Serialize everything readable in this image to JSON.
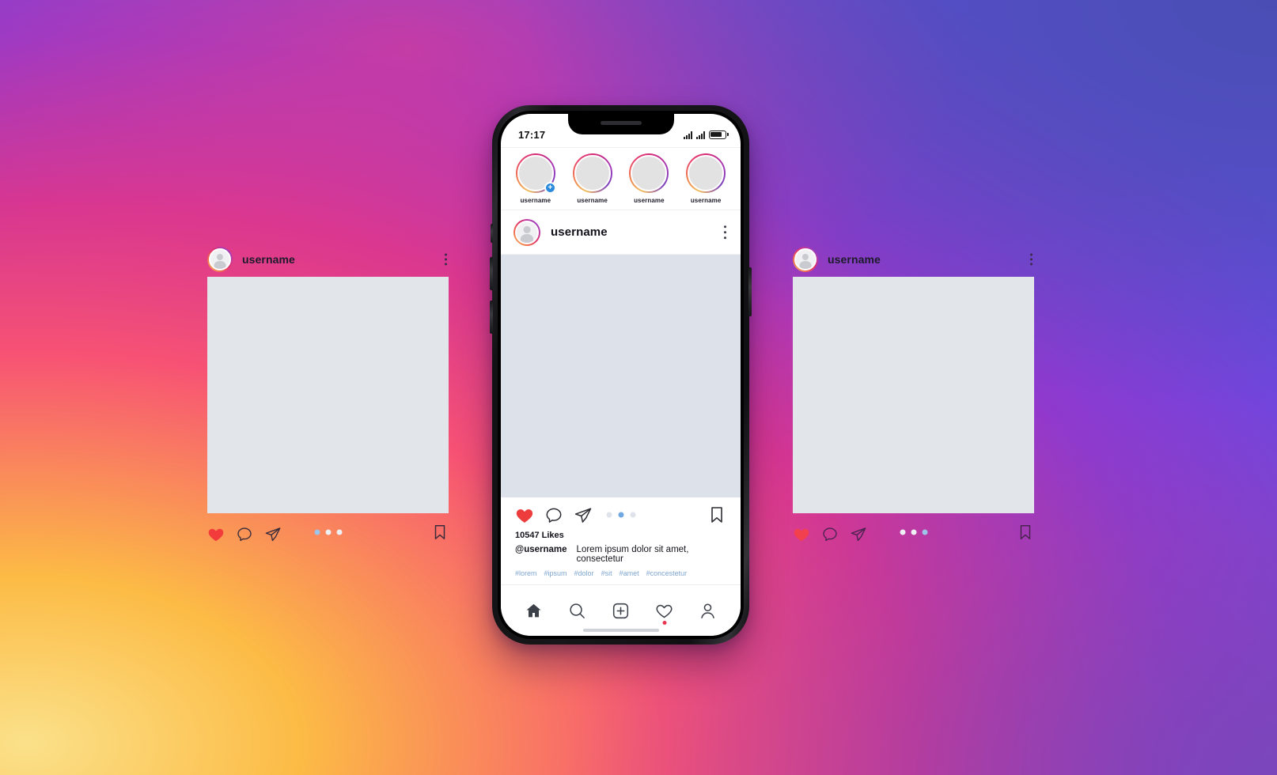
{
  "background": {
    "colors": {
      "yellow": "#fbe18a",
      "orange": "#fcbb45",
      "pink": "#f75274",
      "magenta": "#d53692",
      "purple": "#8f39ce",
      "blue": "#5b4fe9"
    }
  },
  "phone": {
    "status_bar": {
      "time": "17:17",
      "signal_icon_1": "signal-bars-icon",
      "signal_icon_2": "signal-bars-icon",
      "battery_icon": "battery-icon",
      "battery_level_percent": 78
    },
    "stories": [
      {
        "label": "username",
        "has_add_badge": true,
        "add_glyph": "+"
      },
      {
        "label": "username",
        "has_add_badge": false,
        "add_glyph": ""
      },
      {
        "label": "username",
        "has_add_badge": false,
        "add_glyph": ""
      },
      {
        "label": "username",
        "has_add_badge": false,
        "add_glyph": ""
      }
    ],
    "post": {
      "header": {
        "username": "username",
        "avatar_icon": "user-avatar-icon",
        "menu_icon": "more-options-icon"
      },
      "actions": {
        "like_icon": "heart-filled-icon",
        "comment_icon": "comment-bubble-icon",
        "share_icon": "send-paper-plane-icon",
        "save_icon": "bookmark-icon",
        "pager_count": 3,
        "pager_active_index": 1
      },
      "likes": "10547 Likes",
      "caption": {
        "handle": "@username",
        "text": "Lorem ipsum dolor sit amet, consectetur"
      },
      "hashtags": [
        "#lorem",
        "#ipsum",
        "#dolor",
        "#sit",
        "#amet",
        "#concestetur"
      ]
    },
    "tabbar": {
      "items": [
        {
          "icon": "home-icon",
          "active": true,
          "badge": false
        },
        {
          "icon": "search-icon",
          "active": false,
          "badge": false
        },
        {
          "icon": "add-post-icon",
          "active": false,
          "badge": false
        },
        {
          "icon": "heart-icon",
          "active": false,
          "badge": true
        },
        {
          "icon": "profile-icon",
          "active": false,
          "badge": false
        }
      ]
    }
  },
  "cards": [
    {
      "id": "left",
      "username": "username",
      "avatar_icon": "user-avatar-icon",
      "menu_icon": "more-options-icon",
      "like_icon": "heart-filled-icon",
      "comment_icon": "comment-bubble-icon",
      "share_icon": "send-paper-plane-icon",
      "save_icon": "bookmark-icon",
      "pager_count": 3,
      "pager_active_index": 0
    },
    {
      "id": "right",
      "username": "username",
      "avatar_icon": "user-avatar-icon",
      "menu_icon": "more-options-icon",
      "like_icon": "heart-filled-icon",
      "comment_icon": "comment-bubble-icon",
      "share_icon": "send-paper-plane-icon",
      "save_icon": "bookmark-icon",
      "pager_count": 3,
      "pager_active_index": 2
    }
  ]
}
